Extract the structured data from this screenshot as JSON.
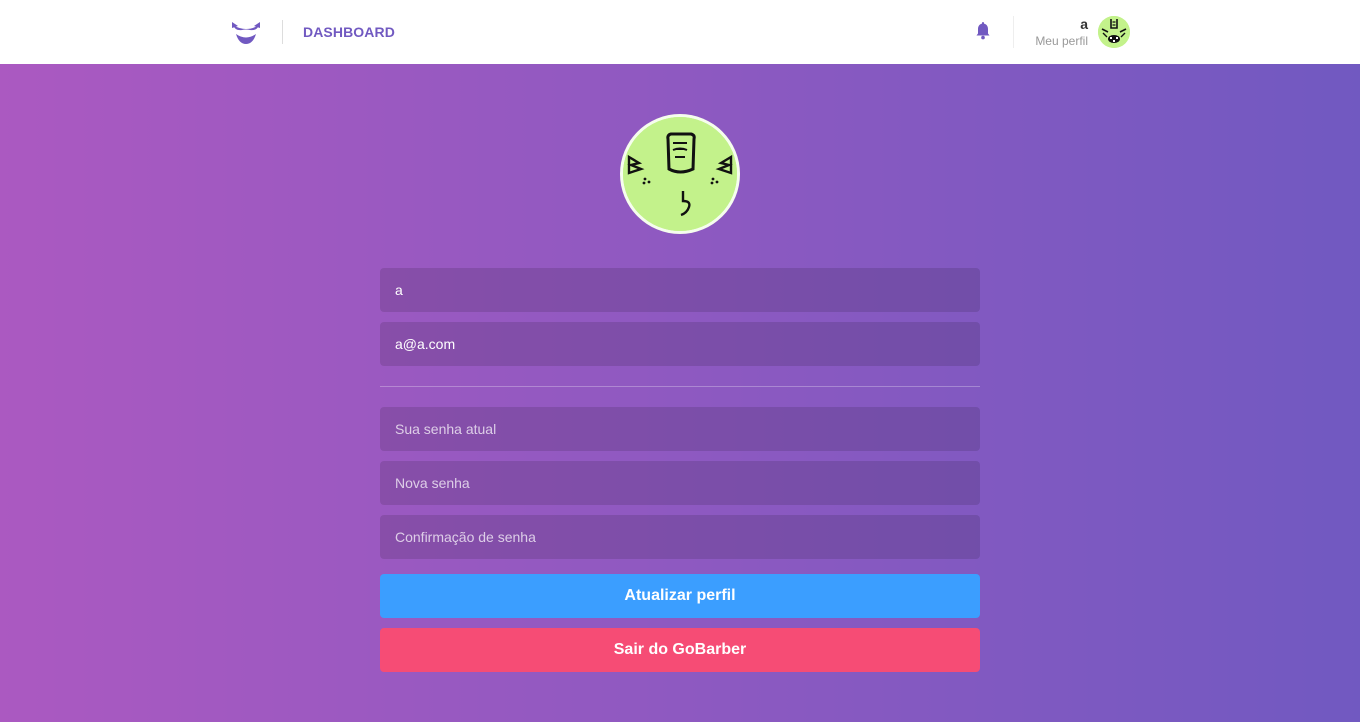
{
  "header": {
    "logo_icon": "mustache-logo-icon",
    "nav_dashboard": "DASHBOARD",
    "notifications_icon": "bell-icon",
    "user_name": "a",
    "profile_link": "Meu perfil",
    "avatar_icon": "green-monster-avatar"
  },
  "profile": {
    "avatar_icon": "green-monster-avatar",
    "name_value": "a",
    "email_value": "a@a.com",
    "old_password_placeholder": "Sua senha atual",
    "new_password_placeholder": "Nova senha",
    "confirm_password_placeholder": "Confirmação de senha",
    "update_button": "Atualizar perfil",
    "logout_button": "Sair do GoBarber"
  },
  "colors": {
    "gradient_start": "#ab59c1",
    "gradient_end": "#7159c1",
    "accent": "#7159c1",
    "update_button": "#3b9eff",
    "logout_button": "#f64c75",
    "avatar_bg": "#c3f28b"
  }
}
